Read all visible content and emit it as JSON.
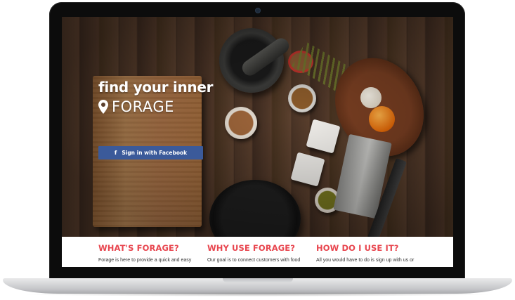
{
  "hero": {
    "tagline": "find your inner",
    "brand_name": "FORAGE",
    "brand_icon": "map-pin-icon",
    "facebook_button": {
      "label": "Sign in with Facebook",
      "icon": "facebook-icon",
      "icon_glyph": "f",
      "color": "#3b5a9a"
    }
  },
  "info": {
    "accent_color": "#e8464f",
    "columns": [
      {
        "heading": "WHAT'S FORAGE?",
        "text": "Forage is here to provide a quick and easy"
      },
      {
        "heading": "WHY USE FORAGE?",
        "text": "Our goal is to connect customers with food"
      },
      {
        "heading": "HOW DO I USE IT?",
        "text": "All you would have to do is sign up with us or"
      }
    ]
  }
}
